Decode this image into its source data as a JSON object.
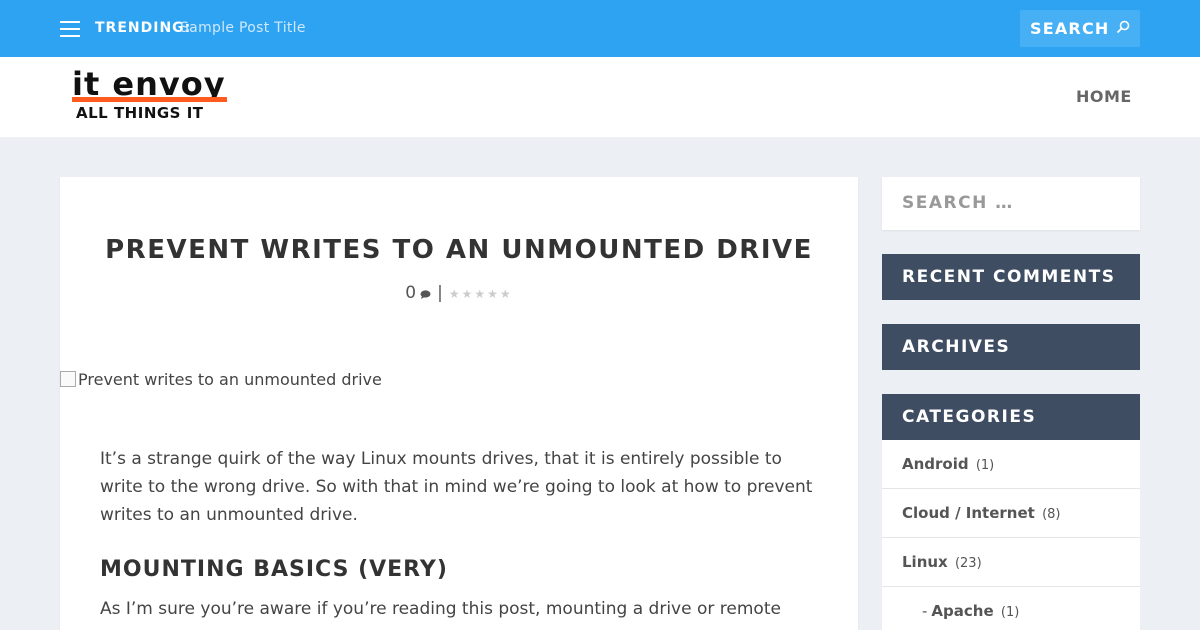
{
  "topbar": {
    "trending_label": "TRENDING:",
    "trending_post": "Sample Post Title",
    "search_placeholder": "SEARCH",
    "accent_color": "#2ea3f2"
  },
  "header": {
    "logo_line1": "it envoy",
    "logo_line2": "ALL THINGS IT",
    "nav": [
      "HOME"
    ]
  },
  "post": {
    "title": "PREVENT WRITES TO AN UNMOUNTED DRIVE",
    "comment_count": "0",
    "meta_separator": "|",
    "rating_stars": 5,
    "image_alt": "Prevent writes to an unmounted drive",
    "paragraph1": "It’s a strange quirk of the way Linux mounts drives, that it is entirely possible to write to the wrong drive.  So with that in mind we’re going to look at how to prevent writes to an unmounted drive.",
    "heading2": "MOUNTING BASICS (VERY)",
    "paragraph2": "As I’m sure you’re aware if you’re reading this post, mounting a drive or remote storage"
  },
  "sidebar": {
    "search_placeholder": "SEARCH …",
    "widgets": [
      "RECENT COMMENTS",
      "ARCHIVES",
      "CATEGORIES"
    ],
    "widget_color": "#3f4d63",
    "categories": [
      {
        "name": "Android",
        "count": "(1)",
        "sub": false
      },
      {
        "name": "Cloud / Internet",
        "count": "(8)",
        "sub": false
      },
      {
        "name": "Linux",
        "count": "(23)",
        "sub": false
      },
      {
        "name": "Apache",
        "count": "(1)",
        "sub": true,
        "dash": "-"
      }
    ]
  }
}
